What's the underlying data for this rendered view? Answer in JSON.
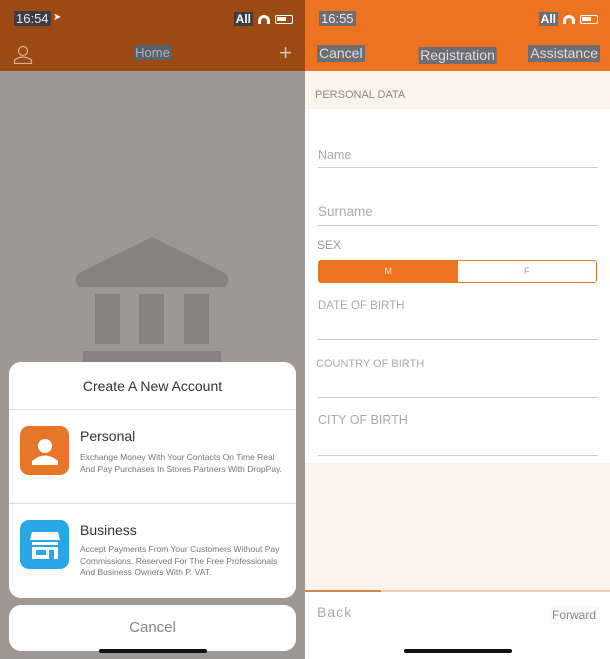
{
  "left": {
    "status": {
      "time": "16:54",
      "network": "All"
    },
    "nav": {
      "title": "Home"
    },
    "sheet": {
      "title": "Create A New Account",
      "options": [
        {
          "title": "Personal",
          "description": "Exchange Money With Your Contacts On Time Real And Pay Purchases In Stores Partners With DropPay.",
          "color": "#e8762a",
          "icon": "person-icon"
        },
        {
          "title": "Business",
          "description": "Accept Payments From Your Customers Without Pay Commissions. Reserved For The Free Professionals And Business Owners With P. VAT.",
          "color": "#2aa6e6",
          "icon": "store-icon"
        }
      ],
      "cancel_label": "Cancel"
    }
  },
  "right": {
    "status": {
      "time": "16:55",
      "network": "All"
    },
    "nav": {
      "cancel_label": "Cancel",
      "title": "Registration",
      "assistance_label": "Assistance"
    },
    "section_header": "PERSONAL DATA",
    "fields": {
      "name_placeholder": "Name",
      "surname_placeholder": "Surname",
      "sex_label": "SEX",
      "sex_options": [
        "M",
        "F"
      ],
      "sex_selected": "M",
      "date_of_birth_label": "DATE OF BIRTH",
      "country_of_birth_label": "COUNTRY OF BIRTH",
      "city_of_birth_label": "CITY OF BIRTH"
    },
    "progress_percent": 25,
    "footer": {
      "back_label": "Back",
      "forward_label": "Forward"
    },
    "accent_color": "#ee7320"
  }
}
